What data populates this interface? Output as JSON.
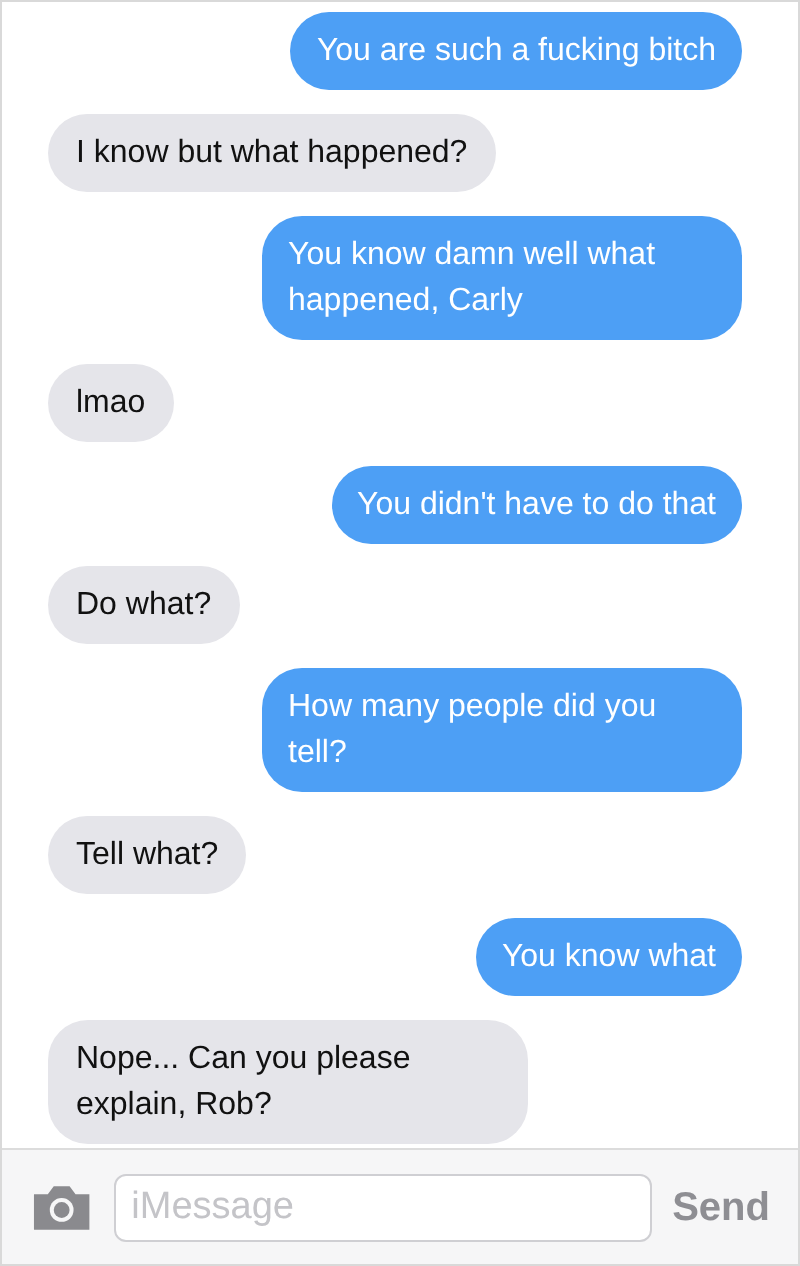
{
  "messages": [
    {
      "kind": "sent",
      "text": "You are such a fucking bitch"
    },
    {
      "kind": "received",
      "text": "I know but what happened?"
    },
    {
      "kind": "sent",
      "text": "You know damn well what happened, Carly"
    },
    {
      "kind": "received",
      "text": "lmao"
    },
    {
      "kind": "sent",
      "text": "You didn't have to do that"
    },
    {
      "kind": "received",
      "text": "Do what?"
    },
    {
      "kind": "sent",
      "text": "How many people did you tell?"
    },
    {
      "kind": "received",
      "text": "Tell what?"
    },
    {
      "kind": "sent",
      "text": "You know what"
    },
    {
      "kind": "received",
      "text": "Nope... Can you please explain, Rob?"
    }
  ],
  "input_bar": {
    "placeholder": "iMessage",
    "send_label": "Send"
  }
}
